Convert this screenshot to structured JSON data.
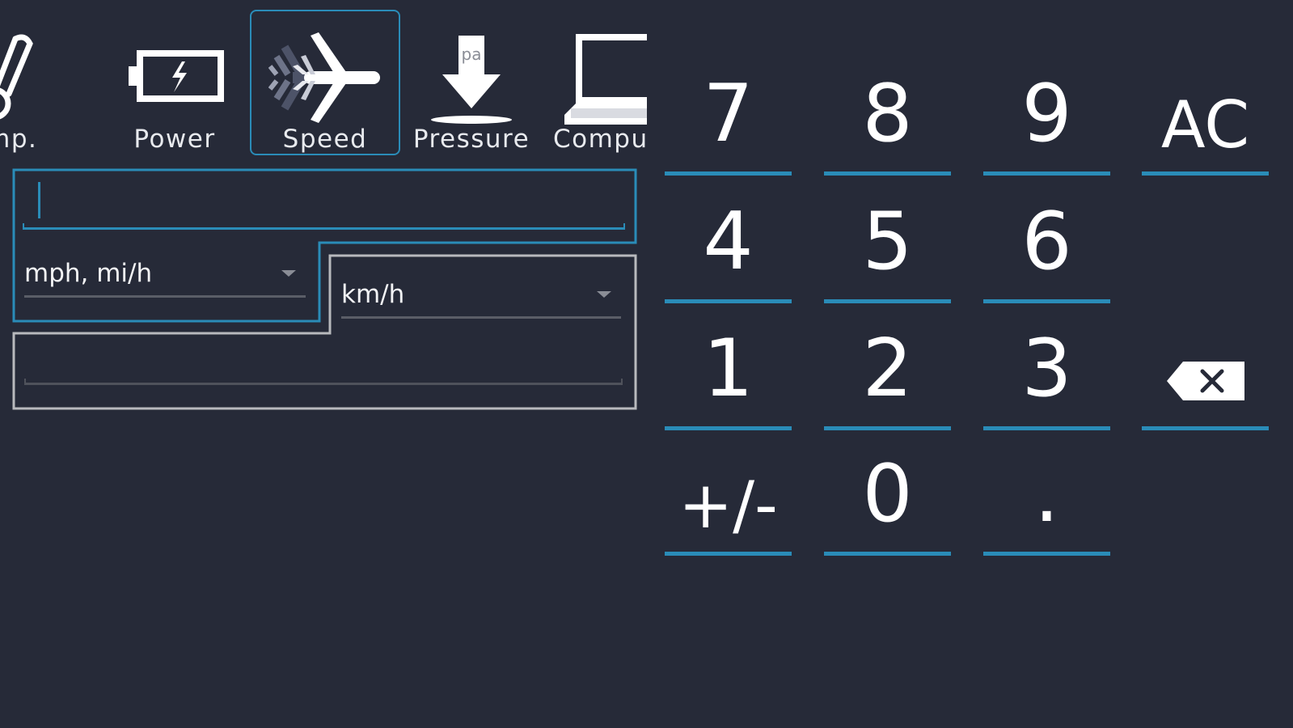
{
  "categories": [
    {
      "id": "temp",
      "label": "emp.",
      "icon": "thermometer-icon"
    },
    {
      "id": "power",
      "label": "Power",
      "icon": "battery-icon"
    },
    {
      "id": "speed",
      "label": "Speed",
      "icon": "airplane-icon",
      "selected": true
    },
    {
      "id": "pressure",
      "label": "Pressure",
      "icon": "pressure-arrow-icon",
      "icon_text": "pa"
    },
    {
      "id": "computer",
      "label": "Compu",
      "icon": "laptop-icon"
    }
  ],
  "converter": {
    "input_value": "",
    "from_unit": "mph, mi/h",
    "to_unit": "km/h",
    "result_value": ""
  },
  "keypad": {
    "keys": [
      "7",
      "8",
      "9",
      "AC",
      "4",
      "5",
      "6",
      "1",
      "2",
      "3",
      "+/-",
      "0",
      "."
    ],
    "backspace_icon": "backspace-icon"
  },
  "colors": {
    "background": "#262a38",
    "accent": "#2a8cb8",
    "text": "#ffffff",
    "inactive_outline": "#b8b9bd"
  }
}
